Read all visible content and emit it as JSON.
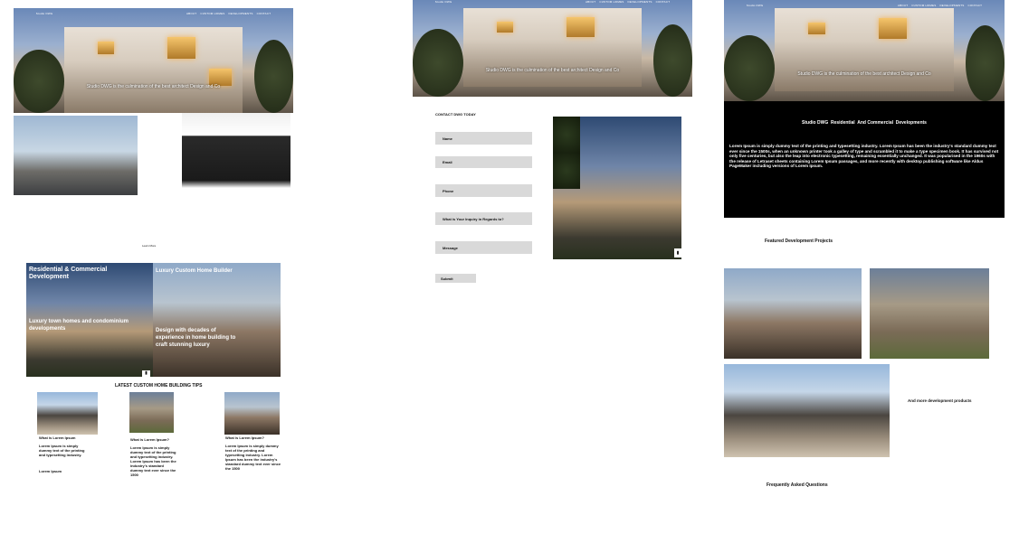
{
  "nav": {
    "brand": "Studio DWG",
    "links": [
      "ABOUT",
      "CUSTOM HOMES",
      "DEVELOPMENTS",
      "CONTACT"
    ]
  },
  "hero": {
    "caption": "Studio DWG is the culmination of the best architect Design and Co"
  },
  "panel1": {
    "learn_more": "Learn More",
    "split_left_title": "Residential & Commercial Development",
    "split_left_sub": "Luxury town homes and condominium developments",
    "split_right_title": "Luxury Custom Home Builder",
    "split_right_sub": "Design with decades of experience in home building to craft stunning luxury",
    "tips_heading": "LATEST CUSTOM HOME BUILDING TIPS",
    "tips": [
      {
        "title": "What is Lorem Ipsum",
        "body": "Lorem Ipsum is simply dummy text of the printing and typesetting industry.",
        "extra": "Lorem Ipsum"
      },
      {
        "title": "What is Lorem Ipsum?",
        "body": "Lorem Ipsum is simply dummy text of the printing and typesetting industry. Lorem Ipsum has been the industry's standard dummy text ever since the 1500",
        "extra": ""
      },
      {
        "title": "What is Lorem Ipsum?",
        "body": "Lorem Ipsum is simply dummy text of the printing and typesetting industry. Lorem Ipsum has been the industry's standard dummy text ever since the 1500",
        "extra": ""
      }
    ]
  },
  "panel2": {
    "contact_heading": "CONTACT DWG TODAY",
    "fields": [
      "Name",
      "Email",
      "Phone",
      "What is Your Inquiry in Regards to?",
      "Message"
    ],
    "submit": "Submit"
  },
  "panel3": {
    "section_title": "Studio DWG  Residential  And Commercial  Developments",
    "section_body": "Lorem Ipsum is simply dummy text of the printing and typesetting industry. Lorem Ipsum has been the industry's standard dummy text ever since the 1500s, when an unknown printer took a galley of type and scrambled it to make a type specimen book. It has survived not only five centuries, but also the leap into electronic typesetting, remaining essentially unchanged. It was popularised in the 1960s with the release of Letraset sheets containing Lorem Ipsum passages, and more recently with desktop publishing software like Aldus PageMaker including versions of Lorem Ipsum.",
    "featured_heading": "Featured Development Projects",
    "more_text": "And more development products",
    "faq_heading": "Frequently Asked Questions"
  },
  "colors": {
    "black_section": "#000000",
    "field_bg": "#d9d9d9"
  }
}
